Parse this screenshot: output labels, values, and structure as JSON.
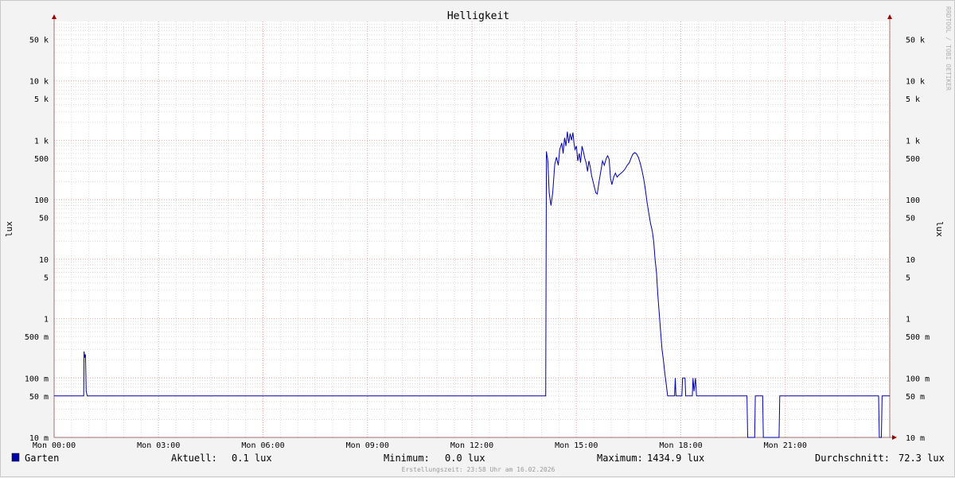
{
  "chart_data": {
    "type": "line",
    "title": "Helligkeit",
    "ylabel": "lux",
    "ylabel_right": "lux",
    "yscale": "log",
    "ylim": [
      0.01,
      100000
    ],
    "xlim": [
      0,
      24
    ],
    "grid": true,
    "x_tick_labels": [
      {
        "h": 0,
        "label": "Mon 00:00"
      },
      {
        "h": 3,
        "label": "Mon 03:00"
      },
      {
        "h": 6,
        "label": "Mon 06:00"
      },
      {
        "h": 9,
        "label": "Mon 09:00"
      },
      {
        "h": 12,
        "label": "Mon 12:00"
      },
      {
        "h": 15,
        "label": "Mon 15:00"
      },
      {
        "h": 18,
        "label": "Mon 18:00"
      },
      {
        "h": 21,
        "label": "Mon 21:00"
      }
    ],
    "y_tick_labels": [
      {
        "v": 0.01,
        "label": "10 m"
      },
      {
        "v": 0.05,
        "label": "50 m"
      },
      {
        "v": 0.1,
        "label": "100 m"
      },
      {
        "v": 0.5,
        "label": "500 m"
      },
      {
        "v": 1,
        "label": "1"
      },
      {
        "v": 5,
        "label": "5"
      },
      {
        "v": 10,
        "label": "10"
      },
      {
        "v": 50,
        "label": "50"
      },
      {
        "v": 100,
        "label": "100"
      },
      {
        "v": 500,
        "label": "500"
      },
      {
        "v": 1000,
        "label": "1 k"
      },
      {
        "v": 5000,
        "label": "5 k"
      },
      {
        "v": 10000,
        "label": "10 k"
      },
      {
        "v": 50000,
        "label": "50 k"
      }
    ],
    "series": [
      {
        "name": "Garten",
        "color": "#0000aa",
        "x_unit": "hours since Mon 00:00",
        "points": [
          [
            0.0,
            0.05
          ],
          [
            0.85,
            0.05
          ],
          [
            0.86,
            0.28
          ],
          [
            0.88,
            0.22
          ],
          [
            0.9,
            0.25
          ],
          [
            0.92,
            0.06
          ],
          [
            0.95,
            0.05
          ],
          [
            14.12,
            0.05
          ],
          [
            14.14,
            650
          ],
          [
            14.18,
            450
          ],
          [
            14.22,
            130
          ],
          [
            14.27,
            80
          ],
          [
            14.32,
            130
          ],
          [
            14.38,
            400
          ],
          [
            14.43,
            520
          ],
          [
            14.48,
            380
          ],
          [
            14.52,
            700
          ],
          [
            14.58,
            900
          ],
          [
            14.62,
            600
          ],
          [
            14.66,
            1100
          ],
          [
            14.7,
            800
          ],
          [
            14.74,
            1400
          ],
          [
            14.78,
            900
          ],
          [
            14.82,
            1300
          ],
          [
            14.86,
            1000
          ],
          [
            14.9,
            1350
          ],
          [
            14.93,
            900
          ],
          [
            14.96,
            700
          ],
          [
            15.0,
            800
          ],
          [
            15.04,
            450
          ],
          [
            15.08,
            600
          ],
          [
            15.12,
            420
          ],
          [
            15.16,
            800
          ],
          [
            15.2,
            650
          ],
          [
            15.24,
            500
          ],
          [
            15.28,
            420
          ],
          [
            15.32,
            300
          ],
          [
            15.36,
            450
          ],
          [
            15.4,
            350
          ],
          [
            15.44,
            250
          ],
          [
            15.48,
            200
          ],
          [
            15.52,
            160
          ],
          [
            15.56,
            130
          ],
          [
            15.6,
            125
          ],
          [
            15.65,
            200
          ],
          [
            15.7,
            300
          ],
          [
            15.75,
            450
          ],
          [
            15.8,
            380
          ],
          [
            15.86,
            500
          ],
          [
            15.9,
            550
          ],
          [
            15.94,
            480
          ],
          [
            15.98,
            230
          ],
          [
            16.02,
            180
          ],
          [
            16.07,
            240
          ],
          [
            16.12,
            280
          ],
          [
            16.17,
            240
          ],
          [
            16.22,
            260
          ],
          [
            16.28,
            280
          ],
          [
            16.34,
            300
          ],
          [
            16.4,
            330
          ],
          [
            16.46,
            380
          ],
          [
            16.52,
            420
          ],
          [
            16.57,
            500
          ],
          [
            16.62,
            580
          ],
          [
            16.67,
            620
          ],
          [
            16.72,
            600
          ],
          [
            16.78,
            520
          ],
          [
            16.83,
            420
          ],
          [
            16.88,
            320
          ],
          [
            16.93,
            230
          ],
          [
            16.98,
            150
          ],
          [
            17.03,
            90
          ],
          [
            17.08,
            60
          ],
          [
            17.13,
            40
          ],
          [
            17.18,
            30
          ],
          [
            17.22,
            20
          ],
          [
            17.26,
            10
          ],
          [
            17.3,
            6
          ],
          [
            17.34,
            2.5
          ],
          [
            17.38,
            1.2
          ],
          [
            17.42,
            0.6
          ],
          [
            17.46,
            0.3
          ],
          [
            17.5,
            0.2
          ],
          [
            17.54,
            0.12
          ],
          [
            17.58,
            0.08
          ],
          [
            17.62,
            0.05
          ],
          [
            17.82,
            0.05
          ],
          [
            17.84,
            0.1
          ],
          [
            17.86,
            0.05
          ],
          [
            18.03,
            0.05
          ],
          [
            18.05,
            0.1
          ],
          [
            18.12,
            0.1
          ],
          [
            18.14,
            0.05
          ],
          [
            18.33,
            0.05
          ],
          [
            18.35,
            0.1
          ],
          [
            18.38,
            0.06
          ],
          [
            18.42,
            0.1
          ],
          [
            18.45,
            0.05
          ],
          [
            19.9,
            0.05
          ],
          [
            19.92,
            0.01
          ],
          [
            20.12,
            0.01
          ],
          [
            20.14,
            0.05
          ],
          [
            20.35,
            0.05
          ],
          [
            20.37,
            0.01
          ],
          [
            20.82,
            0.01
          ],
          [
            20.84,
            0.05
          ],
          [
            23.68,
            0.05
          ],
          [
            23.7,
            0.01
          ],
          [
            23.76,
            0.01
          ],
          [
            23.78,
            0.05
          ],
          [
            24.0,
            0.05
          ]
        ]
      }
    ]
  },
  "legend": {
    "series_name": "Garten",
    "swatch_color": "#0000aa",
    "current_label": "Aktuell:",
    "current_value": "0.1 lux",
    "minimum_label": "Minimum:",
    "minimum_value": "0.0 lux",
    "maximum_label": "Maximum:",
    "maximum_value": "1434.9 lux",
    "average_label": "Durchschnitt:",
    "average_value": "72.3 lux"
  },
  "footer": "Erstellungszeit: 23:58 Uhr am 16.02.2026",
  "watermark": "RRDTOOL / TOBI OETIKER",
  "colors": {
    "grid_major": "#e7a3a3",
    "grid_minor": "#d9d9d9",
    "axis": "#a07070",
    "plot_bg": "#ffffff",
    "line": "#0000aa"
  }
}
